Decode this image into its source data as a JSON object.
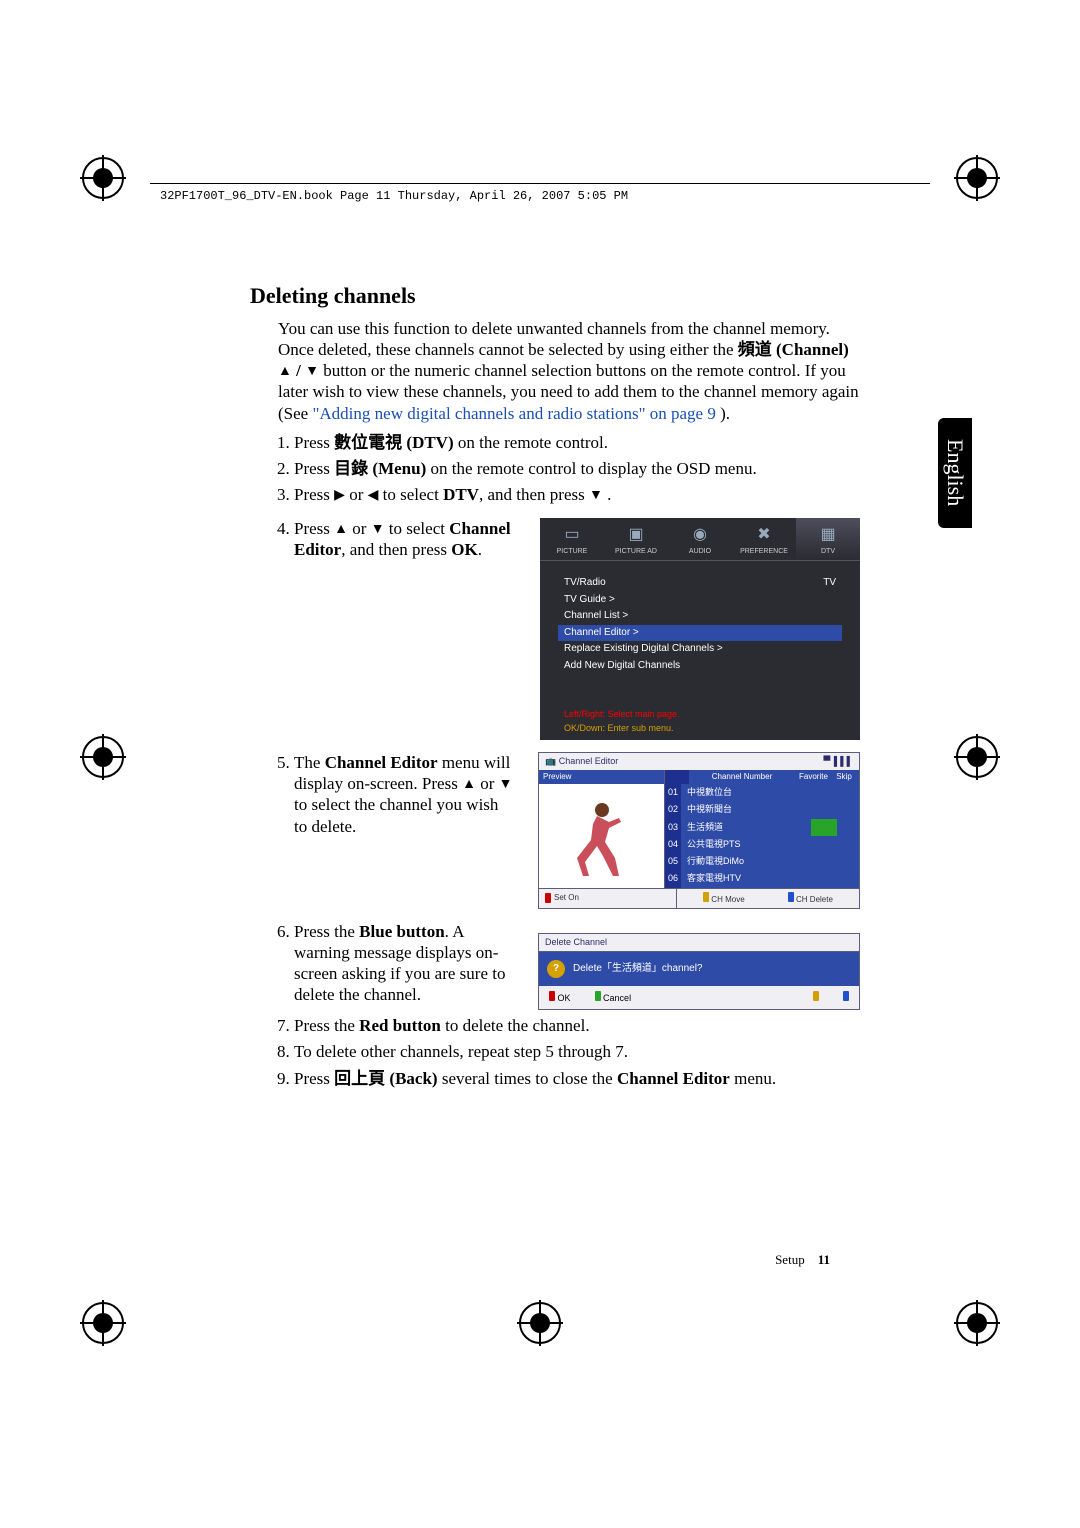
{
  "header_line": "32PF1700T_96_DTV-EN.book  Page 11  Thursday, April 26, 2007  5:05 PM",
  "side_tab": "English",
  "footer_section": "Setup",
  "footer_page": "11",
  "title": "Deleting channels",
  "intro_1": "You can use this function to delete unwanted channels from the channel memory. Once deleted, these channels cannot be selected by using either the ",
  "intro_ch_prefix_cjk": "頻道",
  "intro_ch_label": " (Channel) ",
  "intro_2": " button or the numeric channel selection buttons on the remote control. If you later wish to view these channels, you need to add them to the channel memory again (See ",
  "intro_link": "\"Adding new digital channels and radio stations\" on page 9",
  "intro_3": ").",
  "step1_a": "Press ",
  "step1_cjk": "數位電視",
  "step1_btn": " (DTV)",
  "step1_b": " on the remote control.",
  "step2_a": "Press ",
  "step2_cjk": "目錄",
  "step2_btn": " (Menu)",
  "step2_b": " on the remote control to display the OSD menu.",
  "step3_a": "Press ",
  "step3_b": " or ",
  "step3_c": " to select ",
  "step3_dtv": "DTV",
  "step3_d": ", and then press ",
  "step3_e": " .",
  "step4_a": "Press ",
  "step4_b": " or ",
  "step4_c": " to select ",
  "step4_ce": "Channel Editor",
  "step4_d": ", and then press ",
  "step4_ok": "OK",
  "step4_e": ".",
  "step5_a": "The ",
  "step5_ce": "Channel Editor",
  "step5_b": " menu will display on-screen. Press ",
  "step5_c": " or ",
  "step5_d": " to select the channel you wish to delete.",
  "step6_a": "Press the ",
  "step6_blue": "Blue button",
  "step6_b": ". A warning message displays on-screen asking if you are sure to delete the channel.",
  "step7_a": "Press the ",
  "step7_red": "Red button",
  "step7_b": " to delete the channel.",
  "step8": "To delete other channels, repeat step 5 through 7.",
  "step9_a": "Press ",
  "step9_cjk": "回上頁",
  "step9_btn": " (Back)",
  "step9_b": " several times to close the ",
  "step9_ce": "Channel Editor",
  "step9_c": " menu.",
  "osd": {
    "tabs": [
      "PICTURE",
      "PICTURE AD",
      "AUDIO",
      "PREFERENCE",
      "DTV"
    ],
    "active_tab": 4,
    "lines": [
      {
        "label": "TV/Radio",
        "value": "TV",
        "hl": false
      },
      {
        "label": "TV Guide >",
        "value": "",
        "hl": false
      },
      {
        "label": "Channel List >",
        "value": "",
        "hl": false
      },
      {
        "label": "Channel Editor >",
        "value": "",
        "hl": true
      },
      {
        "label": "Replace Existing Digital Channels >",
        "value": "",
        "hl": false
      },
      {
        "label": "Add New Digital Channels",
        "value": "",
        "hl": false
      }
    ],
    "hint1": "Left/Right: Select main page.",
    "hint2": "OK/Down: Enter sub menu."
  },
  "ce": {
    "title": "Channel Editor",
    "signal": "▝▘▌▌▌",
    "preview": "Preview",
    "col_num": "Channel Number",
    "col_fav": "Favorite",
    "col_skip": "Skip",
    "rows": [
      {
        "n": "01",
        "name": "中視數位台"
      },
      {
        "n": "02",
        "name": "中視新聞台"
      },
      {
        "n": "03",
        "name": "生活頻道",
        "sel": true
      },
      {
        "n": "04",
        "name": "公共電視PTS"
      },
      {
        "n": "05",
        "name": "行動電視DiMo"
      },
      {
        "n": "06",
        "name": "客家電視HTV"
      }
    ],
    "btn_red": "Set On",
    "btn_yellow": "CH Move",
    "btn_blue": "CH Delete"
  },
  "dlg": {
    "title": "Delete Channel",
    "msg": "Delete「生活頻道」channel?",
    "ok": "OK",
    "cancel": "Cancel"
  }
}
